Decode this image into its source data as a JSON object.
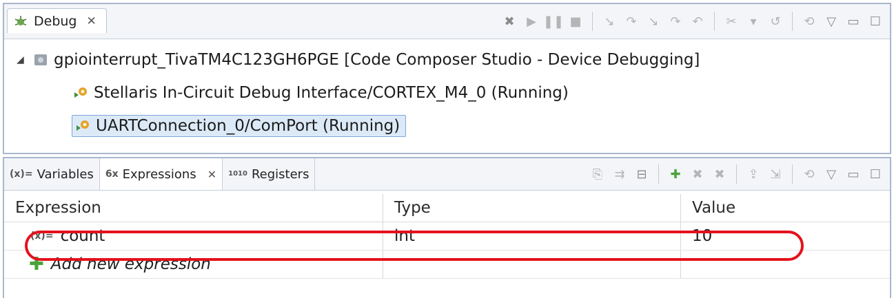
{
  "debug_view": {
    "tab_title": "Debug",
    "tab_close": "✕",
    "toolbar": [
      "remove-all-terminated-icon",
      "resume-icon",
      "suspend-icon",
      "terminate-icon",
      "step-into-icon",
      "step-over-icon",
      "step-return-icon",
      "assembly-step-into-icon",
      "assembly-step-over-icon",
      "reset-icon",
      "restart-icon",
      "connect-icon",
      "view-menu-icon",
      "minimize-icon",
      "maximize-icon"
    ],
    "tree": {
      "root": "gpiointerrupt_TivaTM4C123GH6PGE [Code Composer Studio - Device Debugging]",
      "children": [
        "Stellaris In-Circuit Debug Interface/CORTEX_M4_0 (Running)",
        "UARTConnection_0/ComPort (Running)"
      ]
    }
  },
  "expressions_view": {
    "tabs": [
      {
        "glyph": "(x)=",
        "label": "Variables"
      },
      {
        "glyph": "6x",
        "label": "Expressions",
        "close": "✕"
      },
      {
        "glyph": "1010",
        "label": "Registers"
      }
    ],
    "columns": [
      "Expression",
      "Type",
      "Value"
    ],
    "rows": [
      {
        "expression": "count",
        "type": "int",
        "value": "10"
      }
    ],
    "add_new": "Add new expression"
  },
  "colors": {
    "highlight": "#e3121d",
    "selection": "#dceaf8",
    "add_green": "#4aa33a"
  }
}
